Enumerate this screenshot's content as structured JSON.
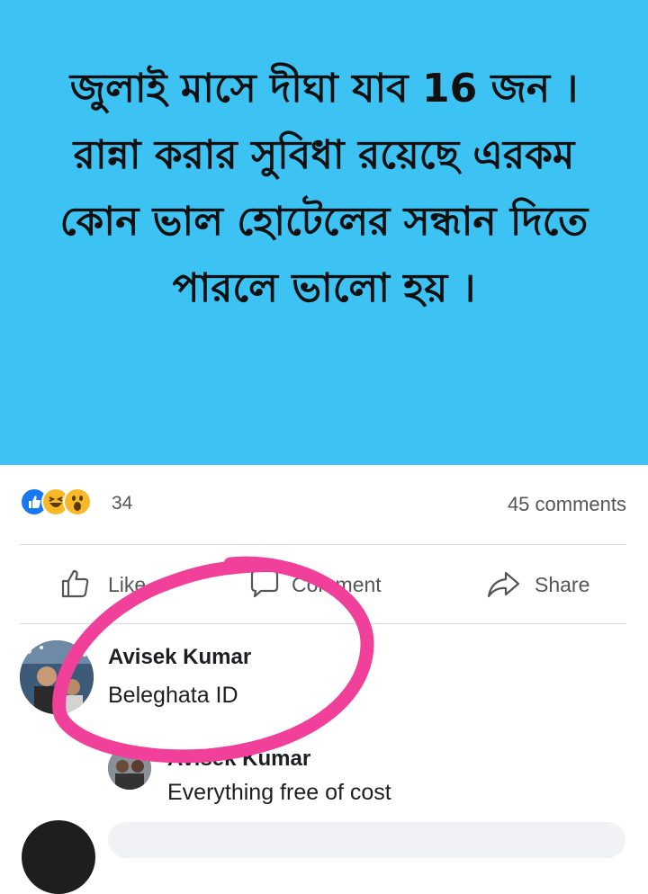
{
  "post": {
    "text": "জুলাই মাসে দীঘা যাব 16 জন । রান্না করার সুবিধা রয়েছে এরকম কোন ভাল হোটেলের সন্ধান দিতে পারলে ভালো হয় ।",
    "background_color": "#3cc3f4"
  },
  "reactions": {
    "icons": [
      "like-icon",
      "haha-icon",
      "wow-icon"
    ],
    "count": "34",
    "comments": "45 comments"
  },
  "actions": {
    "like": "Like",
    "comment": "Comment",
    "share": "Share"
  },
  "comments": [
    {
      "name": "Avisek Kumar",
      "text": "Beleghata ID"
    },
    {
      "name": "Avisek Kumar",
      "text": "Everything free of cost"
    }
  ],
  "colors": {
    "highlight_ring": "#f0409a",
    "like_blue": "#1877f2",
    "emoji_yellow": "#f7b928"
  }
}
